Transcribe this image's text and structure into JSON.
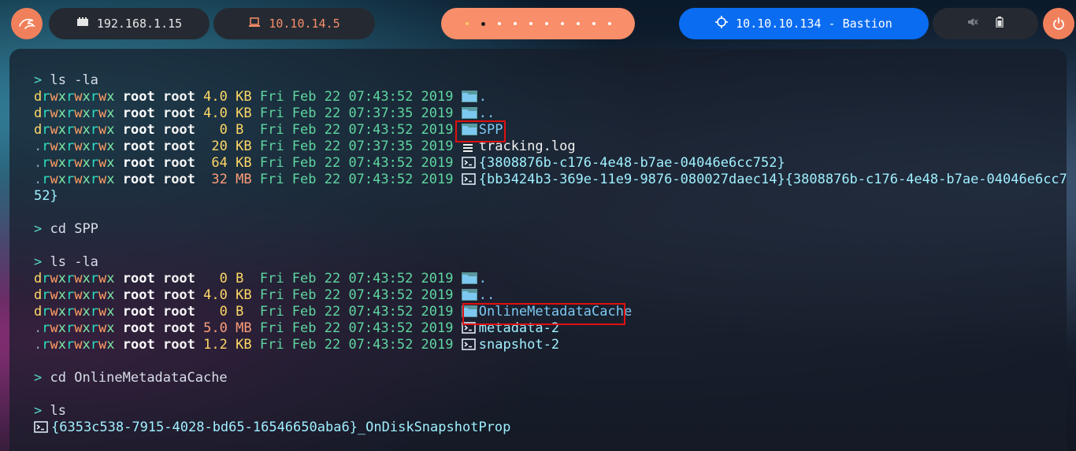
{
  "topbar": {
    "left_ip": "192.168.1.15",
    "vpn_ip": "10.10.14.5",
    "target": "10.10.10.134 - Bastion",
    "workspaces": {
      "count": 10,
      "active_index": 1
    },
    "colors": {
      "accent_orange": "#f98e6a",
      "target_blue": "#0a6cf0",
      "dark_pill": "#252a32"
    }
  },
  "terminal": {
    "lines": [
      {
        "type": "cmd",
        "prompt": ">",
        "text": "ls -la"
      },
      {
        "type": "entry",
        "perms": "drwxrwxrwx",
        "owner": "root",
        "group": "root",
        "size": "4.0",
        "unit": "KB",
        "date": "Fri Feb 22 07:43:52 2019",
        "icon": "folder-icon",
        "name": "."
      },
      {
        "type": "entry",
        "perms": "drwxrwxrwx",
        "owner": "root",
        "group": "root",
        "size": "4.0",
        "unit": "KB",
        "date": "Fri Feb 22 07:37:35 2019",
        "icon": "folder-icon",
        "name": ".."
      },
      {
        "type": "entry",
        "perms": "drwxrwxrwx",
        "owner": "root",
        "group": "root",
        "size": "0",
        "unit": "B",
        "date": "Fri Feb 22 07:43:52 2019",
        "icon": "folder-icon",
        "name": "SPP"
      },
      {
        "type": "entry",
        "perms": ".rwxrwxrwx",
        "owner": "root",
        "group": "root",
        "size": "20",
        "unit": "KB",
        "date": "Fri Feb 22 07:37:35 2019",
        "icon": "log-icon",
        "name": "tracking.log"
      },
      {
        "type": "entry",
        "perms": ".rwxrwxrwx",
        "owner": "root",
        "group": "root",
        "size": "64",
        "unit": "KB",
        "date": "Fri Feb 22 07:43:52 2019",
        "icon": "terminal-file-icon",
        "name": "{3808876b-c176-4e48-b7ae-04046e6cc752}"
      },
      {
        "type": "entry",
        "perms": ".rwxrwxrwx",
        "owner": "root",
        "group": "root",
        "size": "32",
        "unit": "MB",
        "date": "Fri Feb 22 07:43:52 2019",
        "icon": "terminal-file-icon",
        "name": "{bb3424b3-369e-11e9-9876-080027daec14}{3808876b-c176-4e48-b7ae-04046e6cc7"
      },
      {
        "type": "wrap",
        "text": "52}"
      },
      {
        "type": "blank"
      },
      {
        "type": "cmd",
        "prompt": ">",
        "text": "cd SPP"
      },
      {
        "type": "blank"
      },
      {
        "type": "cmd",
        "prompt": ">",
        "text": "ls -la"
      },
      {
        "type": "entry",
        "perms": "drwxrwxrwx",
        "owner": "root",
        "group": "root",
        "size": "0",
        "unit": "B",
        "date": "Fri Feb 22 07:43:52 2019",
        "icon": "folder-icon",
        "name": "."
      },
      {
        "type": "entry",
        "perms": "drwxrwxrwx",
        "owner": "root",
        "group": "root",
        "size": "4.0",
        "unit": "KB",
        "date": "Fri Feb 22 07:43:52 2019",
        "icon": "folder-icon",
        "name": ".."
      },
      {
        "type": "entry",
        "perms": "drwxrwxrwx",
        "owner": "root",
        "group": "root",
        "size": "0",
        "unit": "B",
        "date": "Fri Feb 22 07:43:52 2019",
        "icon": "folder-icon",
        "name": "OnlineMetadataCache"
      },
      {
        "type": "entry",
        "perms": ".rwxrwxrwx",
        "owner": "root",
        "group": "root",
        "size": "5.0",
        "unit": "MB",
        "date": "Fri Feb 22 07:43:52 2019",
        "icon": "terminal-file-icon",
        "name": "metadata-2"
      },
      {
        "type": "entry",
        "perms": ".rwxrwxrwx",
        "owner": "root",
        "group": "root",
        "size": "1.2",
        "unit": "KB",
        "date": "Fri Feb 22 07:43:52 2019",
        "icon": "terminal-file-icon",
        "name": "snapshot-2"
      },
      {
        "type": "blank"
      },
      {
        "type": "cmd",
        "prompt": ">",
        "text": "cd OnlineMetadataCache"
      },
      {
        "type": "blank"
      },
      {
        "type": "cmd",
        "prompt": ">",
        "text": "ls"
      },
      {
        "type": "plainfile",
        "icon": "terminal-file-icon",
        "name": "{6353c538-7915-4028-bd65-16546650aba6}_OnDiskSnapshotProp"
      }
    ]
  }
}
